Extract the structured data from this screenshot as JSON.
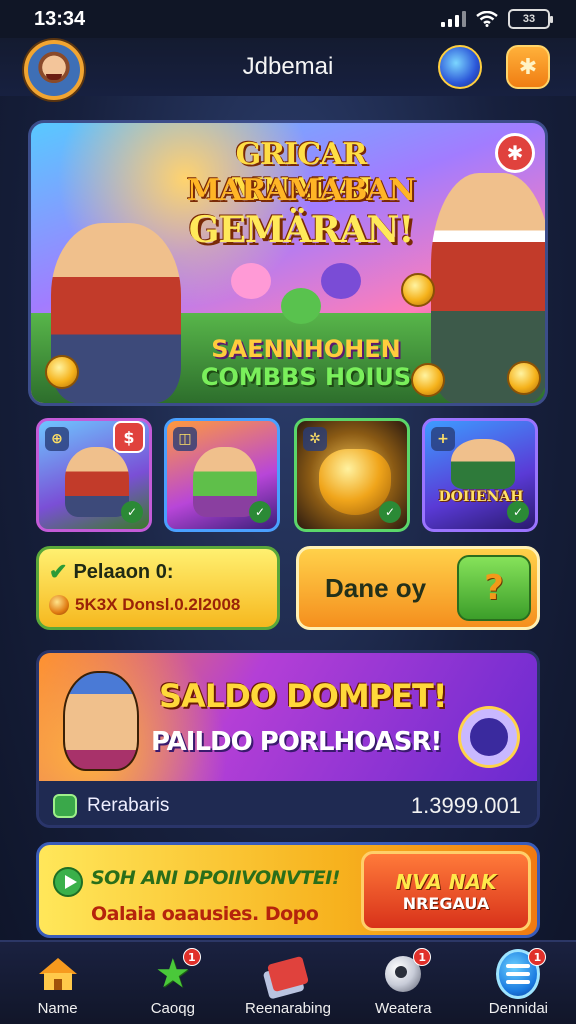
{
  "status_bar": {
    "time": "13:34",
    "battery": "33"
  },
  "header": {
    "title": "Jdbemai",
    "avatar_icon": "hero-avatar-icon",
    "globe_icon": "globe-icon",
    "star_icon": "star-icon"
  },
  "hero": {
    "title_line1": "GRICAR MNAUAI",
    "title_line2": "MARAMABAN",
    "title_line3": "GEMÄRAN!",
    "sub_line1": "SAENNHOHEN",
    "sub_line2": "COMBBS HOIUS",
    "badge": "✱"
  },
  "tiles": [
    {
      "corner": "⊕",
      "badge": "$",
      "check": "✓"
    },
    {
      "corner": "◫",
      "check": "✓"
    },
    {
      "corner": "✲",
      "check": "✓"
    },
    {
      "corner": "+",
      "label": "DOIIENAH",
      "check": "✓"
    }
  ],
  "balance": {
    "label": "Pelaaon 0:",
    "value": "5K3X Donsl.0.2l2008"
  },
  "action": {
    "label": "Dane oy",
    "icon": "?"
  },
  "promo": {
    "title": "SALDO DOMPET!",
    "subtitle": "PAILDO PORLHOASR!",
    "footer_label": "Rerabaris",
    "footer_value": "1.3999.001"
  },
  "promo_bar": {
    "line1": "SOH ANI DPOIIVONVTEI!",
    "line2": "Oalaia oaausies. Dopo",
    "button_line1": "NVA NAK",
    "button_line2": "NREGAUA"
  },
  "nav": [
    {
      "label": "Name",
      "icon": "home-icon",
      "badge": ""
    },
    {
      "label": "Caoqg",
      "icon": "star-icon",
      "badge": "1"
    },
    {
      "label": "Reenarabing",
      "icon": "cards-icon",
      "badge": ""
    },
    {
      "label": "Weatera",
      "icon": "ball-icon",
      "badge": "1"
    },
    {
      "label": "Dennidai",
      "icon": "menu-icon",
      "badge": "1"
    }
  ],
  "colors": {
    "accent": "#f79a1e",
    "green": "#4ac83a",
    "danger": "#e0302a",
    "background": "#17203d"
  }
}
